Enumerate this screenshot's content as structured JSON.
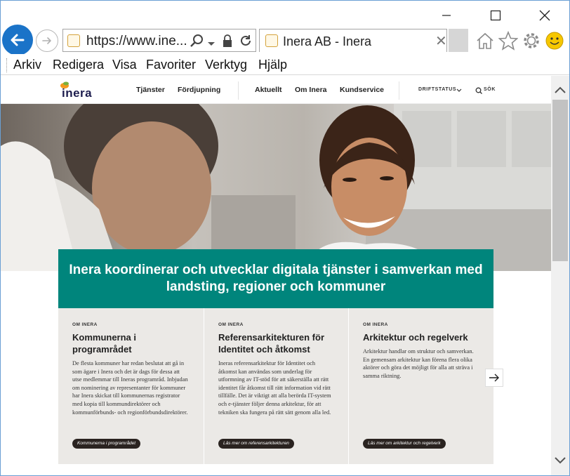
{
  "browser": {
    "url": "https://www.ine...",
    "tab_title": "Inera AB - Inera",
    "tab_close": "✕",
    "menu": [
      "Arkiv",
      "Redigera",
      "Visa",
      "Favoriter",
      "Verktyg",
      "Hjälp"
    ],
    "toolbar_icons": [
      "home-icon",
      "star-icon",
      "gear-icon",
      "smiley-icon"
    ]
  },
  "site": {
    "logo_text": "inera",
    "nav": {
      "tjanster": "Tjänster",
      "fordjupning": "Fördjupning",
      "aktuellt": "Aktuellt",
      "om_inera": "Om Inera",
      "kundservice": "Kundservice",
      "driftstatus": "DRIFTSTATUS",
      "sok": "SÖK"
    },
    "banner": "Inera koordinerar och utvecklar digitala tjänster i samverkan med landsting, regioner och kommuner",
    "cards": [
      {
        "kicker": "OM INERA",
        "title": "Kommunerna i programrådet",
        "body": "De flesta kommuner har redan beslutat att gå in som ägare i Inera och det är dags för dessa att utse medlemmar till Ineras programråd. Inbjudan om nominering av representanter för kommuner har Inera skickat till kommunernas registrator med kopia till kommundirektörer och kommunförbunds- och regionförbundsdirektörer.",
        "button": "Kommunerna i programrådet"
      },
      {
        "kicker": "OM INERA",
        "title": "Referensarkitekturen för Identitet och åtkomst",
        "body": "Ineras referensarkitektur för Identitet och åtkomst kan användas som underlag för utformning av IT-stöd för att säkerställa att rätt identitet får åtkomst till rätt information vid rätt tillfälle. Det är viktigt att alla berörda IT-system och e-tjänster följer denna arkitektur, för att tekniken ska fungera på rätt sätt genom alla led.",
        "button": "Läs mer om referensarkitekturen"
      },
      {
        "kicker": "OM INERA",
        "title": "Arkitektur och regelverk",
        "body": "Arkitektur handlar om struktur och samverkan. En gemensam arkitektur kan förena flera olika aktörer och göra det möjligt för alla att sträva i samma riktning.",
        "button": "Läs mer om arkitektur och regelverk"
      }
    ]
  },
  "colors": {
    "accent": "#00857c",
    "back_button": "#1a73c8",
    "card_bg": "#ebe9e6"
  }
}
